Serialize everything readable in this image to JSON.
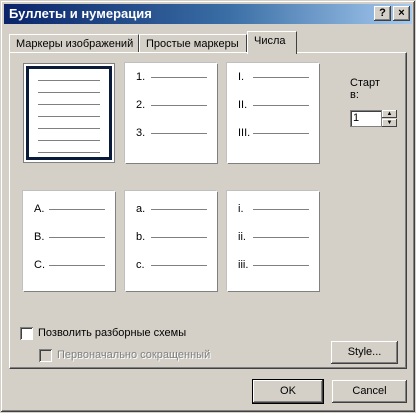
{
  "window": {
    "title": "Буллеты и нумерация",
    "help_glyph": "?",
    "close_glyph": "×"
  },
  "tabs": [
    {
      "label": "Маркеры изображений",
      "active": false
    },
    {
      "label": "Простые маркеры",
      "active": false
    },
    {
      "label": "Числа",
      "active": true
    }
  ],
  "tiles": [
    {
      "markers": [
        "",
        "",
        ""
      ],
      "selected": true
    },
    {
      "markers": [
        "1.",
        "2.",
        "3."
      ],
      "selected": false
    },
    {
      "markers": [
        "I.",
        "II.",
        "III."
      ],
      "selected": false
    },
    {
      "markers": [
        "A.",
        "B.",
        "C."
      ],
      "selected": false
    },
    {
      "markers": [
        "a.",
        "b.",
        "c."
      ],
      "selected": false
    },
    {
      "markers": [
        "i.",
        "ii.",
        "iii."
      ],
      "selected": false
    }
  ],
  "start": {
    "label": "Старт в:",
    "value": "1"
  },
  "options": {
    "allow_outline_label": "Позволить разборные схемы",
    "allow_outline_checked": false,
    "initially_collapsed_label": "Первоначально сокращенный",
    "initially_collapsed_checked": false
  },
  "buttons": {
    "style_label": "Style...",
    "ok_label": "OK",
    "cancel_label": "Cancel"
  },
  "colors": {
    "titlebar_start": "#0a246a",
    "face": "#d4d0c8"
  }
}
